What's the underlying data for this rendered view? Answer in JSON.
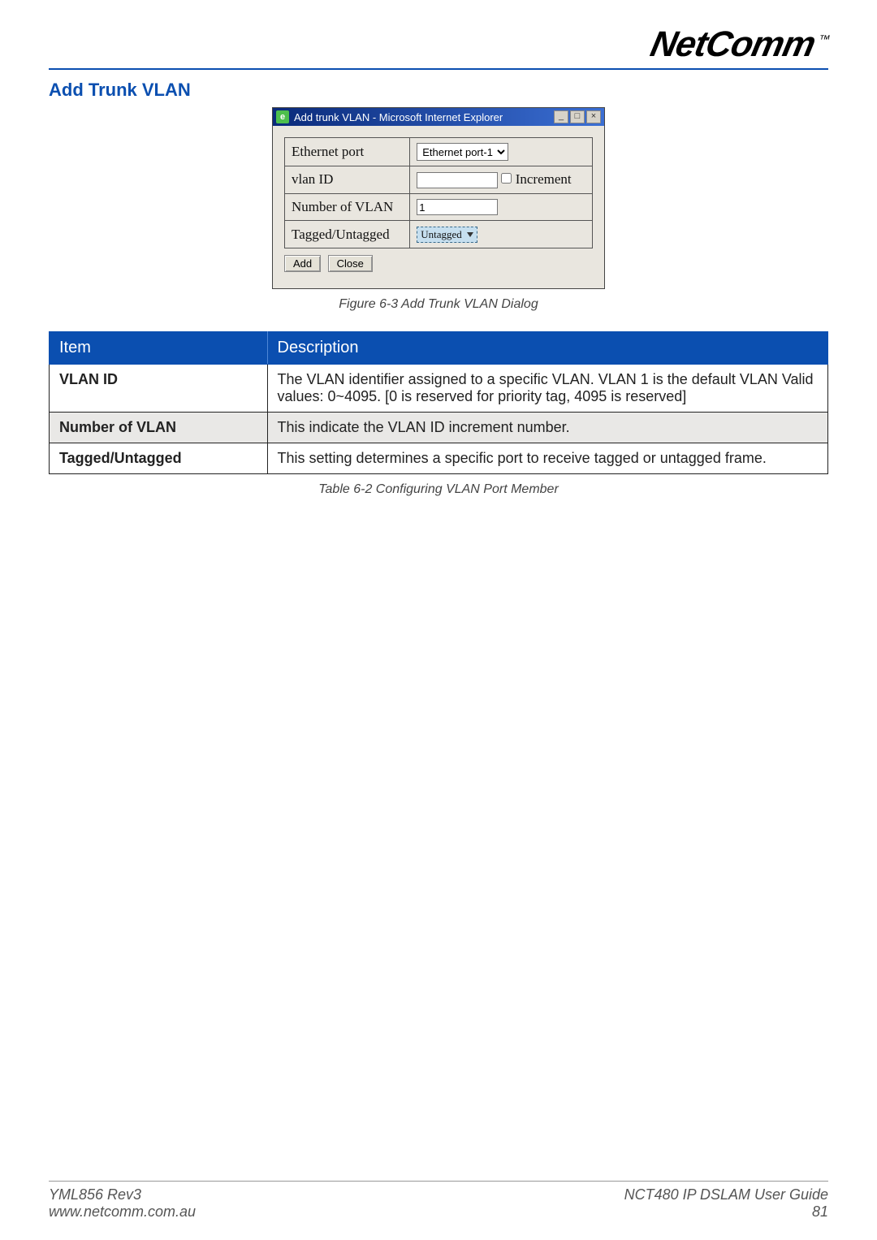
{
  "logo": {
    "text": "NetComm",
    "tm": "™"
  },
  "section_title": "Add Trunk VLAN",
  "dialog": {
    "title": "Add trunk VLAN - Microsoft Internet Explorer",
    "rows": {
      "ethernet_port_label": "Ethernet port",
      "ethernet_port_value": "Ethernet port-1",
      "vlan_id_label": "vlan ID",
      "vlan_id_value": "",
      "increment_label": "Increment",
      "num_vlan_label": "Number of VLAN",
      "num_vlan_value": "1",
      "tagged_label": "Tagged/Untagged",
      "tagged_value": "Untagged"
    },
    "buttons": {
      "add": "Add",
      "close": "Close"
    }
  },
  "figure_caption": "Figure 6-3 Add Trunk VLAN Dialog",
  "table": {
    "headers": {
      "item": "Item",
      "desc": "Description"
    },
    "rows": [
      {
        "item": "VLAN ID",
        "desc": "The VLAN identifier assigned to a specific VLAN. VLAN 1 is the default VLAN Valid values: 0~4095. [0 is reserved for priority tag, 4095 is reserved]"
      },
      {
        "item": "Number of VLAN",
        "desc": "This indicate the VLAN ID increment number."
      },
      {
        "item": "Tagged/Untagged",
        "desc": "This setting determines a specific port to receive tagged or untagged frame."
      }
    ]
  },
  "table_caption": "Table 6-2 Configuring VLAN Port Member",
  "footer": {
    "left1": "YML856 Rev3",
    "left2": "www.netcomm.com.au",
    "right1": "NCT480 IP DSLAM User Guide",
    "right2": "81"
  }
}
